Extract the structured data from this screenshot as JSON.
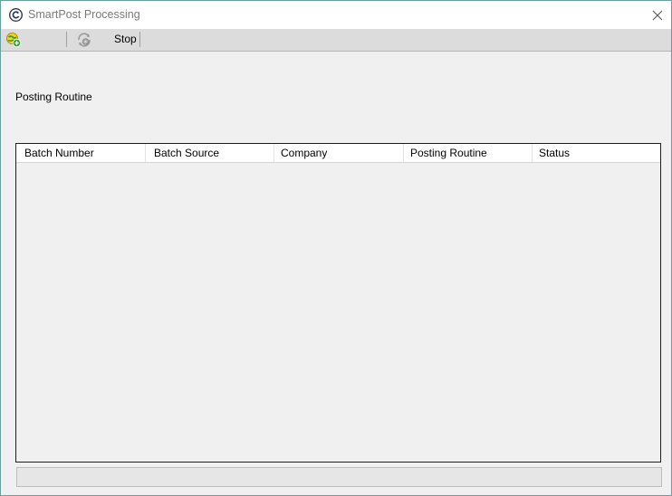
{
  "window": {
    "title": "SmartPost Processing"
  },
  "toolbar": {
    "add_icon": "add-globe-icon",
    "process_icon": "settings-cycle-icon",
    "stop_label": "Stop"
  },
  "main": {
    "posting_routine_label": "Posting Routine"
  },
  "table": {
    "columns": [
      "Batch Number",
      "Batch Source",
      "Company",
      "Posting Routine",
      "Status"
    ],
    "rows": []
  },
  "colors": {
    "border_accent": "#6b9e9e",
    "window_bg": "#f0f0f0",
    "toolbar_bg": "#dcdcdc"
  }
}
